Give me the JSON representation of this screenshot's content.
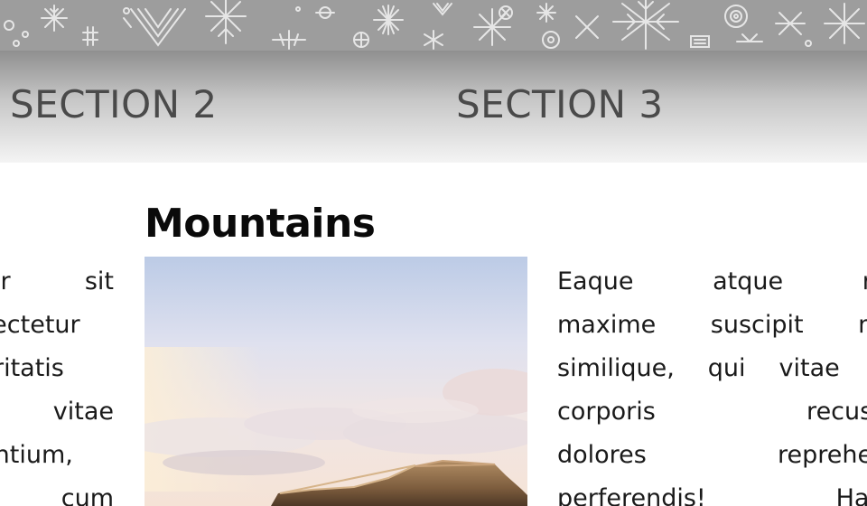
{
  "nav": {
    "items": [
      {
        "label": "SECTION 2"
      },
      {
        "label": "SECTION 3"
      }
    ]
  },
  "article": {
    "title": "Mountains",
    "left_column_lines": [
      "olor sit",
      "nsectetur",
      "Veritatis",
      "in vitae",
      "dantium,",
      "e cum"
    ],
    "right_column_lines": [
      "Eaque atque ratio",
      "maxime suscipit maio",
      "similique, qui vitae ean",
      "corporis recusand",
      "dolores reprehende",
      "perferendis! Harum"
    ]
  },
  "colors": {
    "banner": "#9d9d9d",
    "nav_text": "#4a4a4a",
    "title_text": "#0a0a0a",
    "body_text": "#1a1a1a"
  },
  "icons": {
    "banner_pattern": "snowflake-folk-pattern"
  }
}
